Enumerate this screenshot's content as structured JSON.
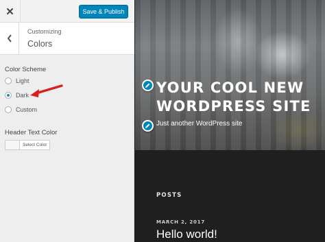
{
  "header": {
    "close_icon": "close-icon",
    "save_label": "Save & Publish"
  },
  "section": {
    "back_icon": "chevron-left-icon",
    "breadcrumb": "Customizing",
    "title": "Colors"
  },
  "color_scheme": {
    "title": "Color Scheme",
    "options": [
      {
        "label": "Light",
        "selected": false
      },
      {
        "label": "Dark",
        "selected": true
      },
      {
        "label": "Custom",
        "selected": false
      }
    ],
    "annotation_arrow_color": "#d9201f"
  },
  "header_text_color": {
    "title": "Header Text Color",
    "button_label": "Select Color"
  },
  "preview": {
    "site_title": "YOUR COOL NEW WORDPRESS SITE",
    "tagline": "Just another WordPress site",
    "posts_heading": "POSTS",
    "post_date": "MARCH 2, 2017",
    "post_title": "Hello world!",
    "edit_icon": "pencil-icon"
  },
  "colors": {
    "accent": "#0085ba",
    "sidebar_bg": "#eeeeee",
    "preview_dark": "#1f1f1f"
  }
}
